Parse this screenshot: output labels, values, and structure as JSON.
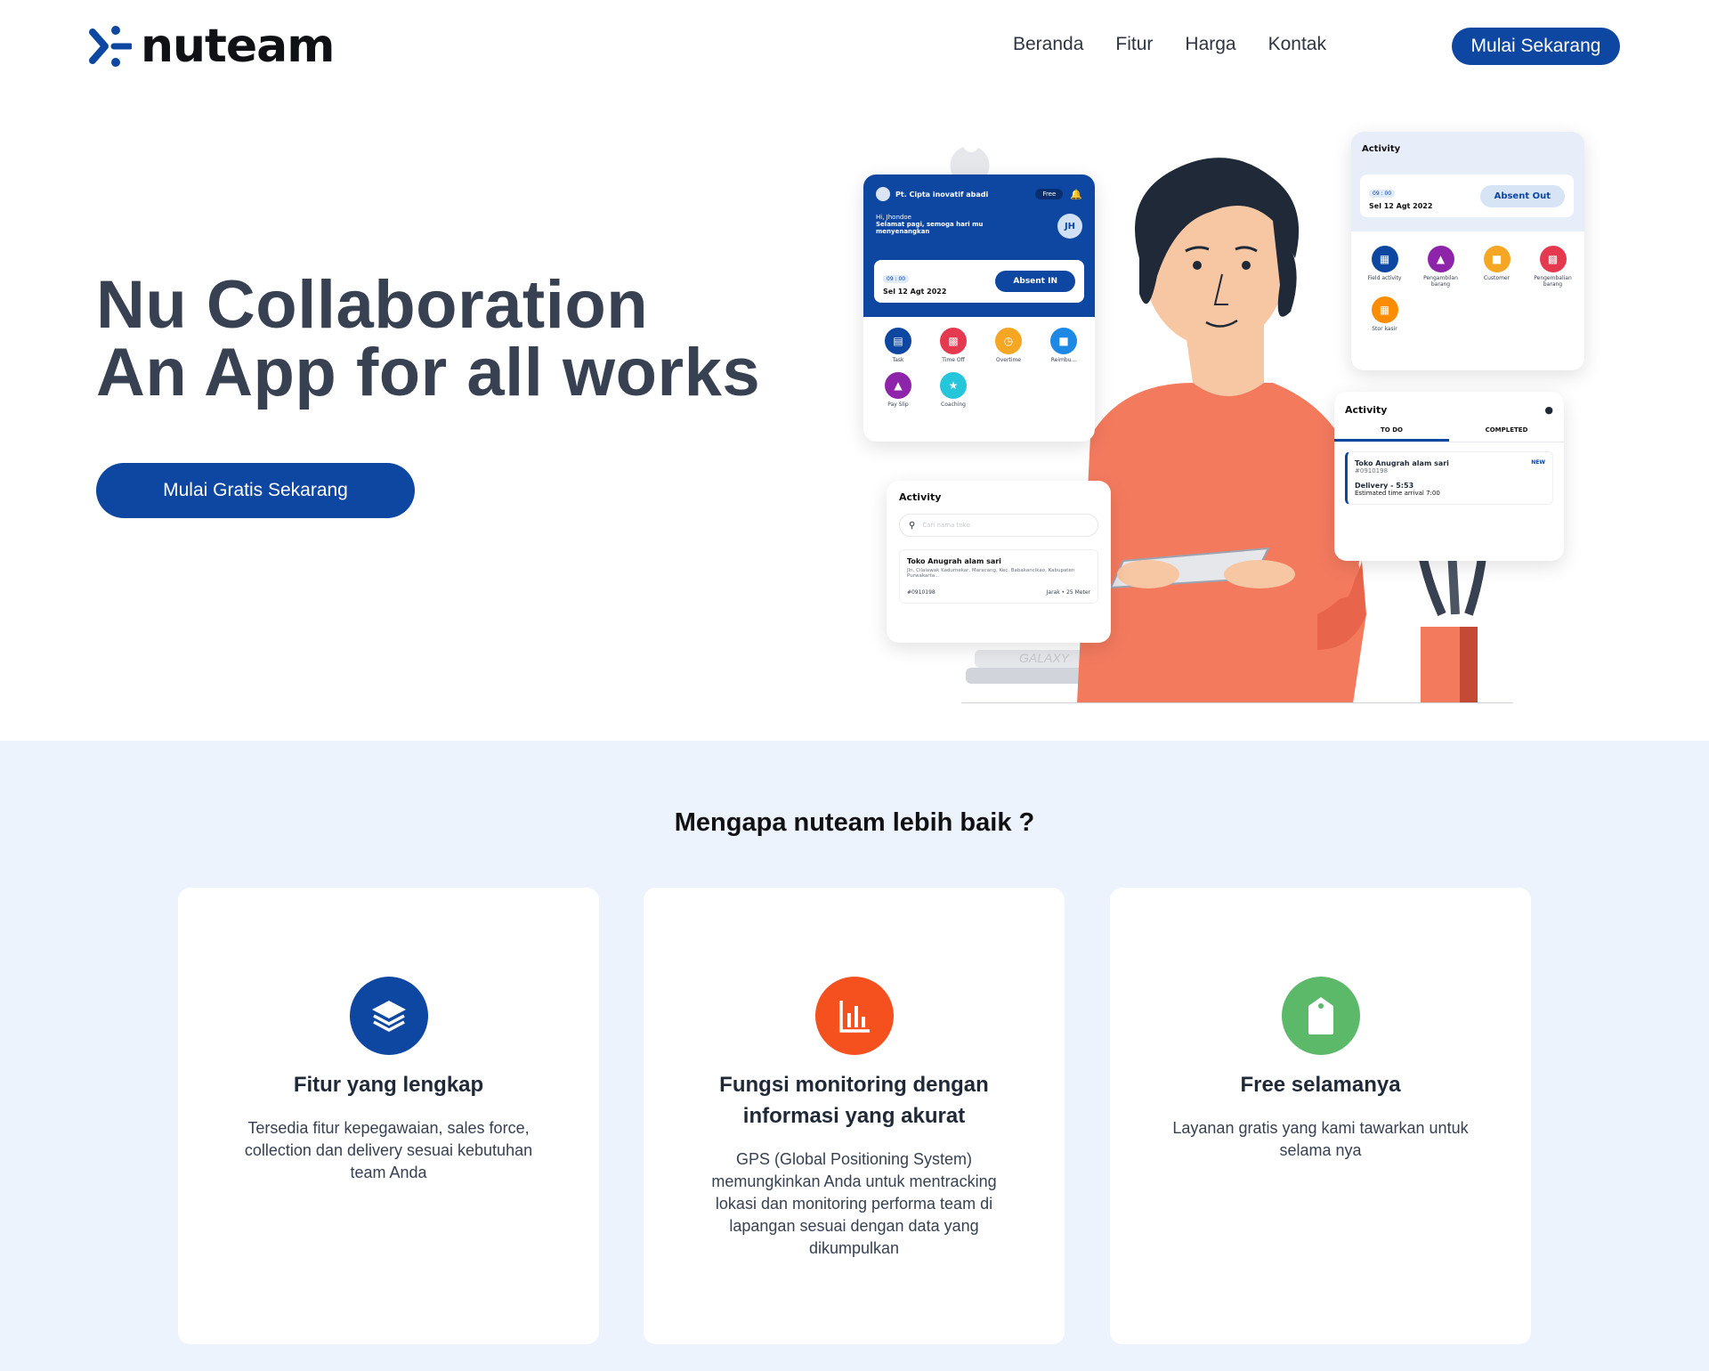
{
  "brand": {
    "name": "nuteam",
    "color": "#0d47a1"
  },
  "nav": {
    "links": [
      "Beranda",
      "Fitur",
      "Harga",
      "Kontak"
    ],
    "cta": "Mulai Sekarang"
  },
  "hero": {
    "title_line1": "Nu Collaboration",
    "title_line2": "An App for all works",
    "cta": "Mulai Gratis Sekarang"
  },
  "mock": {
    "company": "Pt. Cipta inovatif abadi",
    "plan": "Free",
    "greeting": "Hi, Jhondoe",
    "greeting_sub": "Selamat pagi, semoga hari mu menyenangkan",
    "avatar_initials": "JH",
    "time": "09 : 00",
    "date": "Sel 12 Agt 2022",
    "absent_in": "Absent IN",
    "absent_out": "Absent Out",
    "menu": [
      "Task",
      "Time Off",
      "Overtime",
      "Reimbu...",
      "Pay Slip",
      "Coaching"
    ],
    "activity_title": "Activity",
    "search_placeholder": "Cari nama toko",
    "store_name": "Toko Anugrah alam sari",
    "store_address": "Jln. Cilalawak Kadumekar, Maracang, Kec. Babakancikao, Kabupaten Purwakarta...",
    "store_id": "#0910198",
    "store_distance": "Jarak • 25 Meter",
    "activity_menu": [
      "Field activity",
      "Pengambilan barang",
      "Customer",
      "Pengembalian barang",
      "Stor kasir"
    ],
    "tab_todo": "TO DO",
    "tab_completed": "COMPLETED",
    "todo_name": "Toko Anugrah alam sari",
    "todo_id": "#0910198",
    "todo_new": "NEW",
    "todo_delivery": "Delivery - 5:53",
    "todo_eta": "Estimated time arrival 7:00",
    "device_text": "GALAXY"
  },
  "why": {
    "title": "Mengapa nuteam lebih baik ?",
    "cards": [
      {
        "title": "Fitur yang lengkap",
        "desc": "Tersedia fitur kepegawaian, sales force, collection dan delivery sesuai kebutuhan team Anda",
        "icon": "layers-icon",
        "color": "#0d47a1"
      },
      {
        "title": "Fungsi monitoring dengan informasi yang akurat",
        "desc": "GPS (Global Positioning System) memungkinkan Anda untuk mentracking lokasi dan monitoring performa team di lapangan sesuai dengan data yang dikumpulkan",
        "icon": "chart-icon",
        "color": "#f4511e"
      },
      {
        "title": "Free selamanya",
        "desc": "Layanan gratis yang kami tawarkan untuk selama nya",
        "icon": "tag-icon",
        "color": "#5cb96a"
      }
    ]
  }
}
